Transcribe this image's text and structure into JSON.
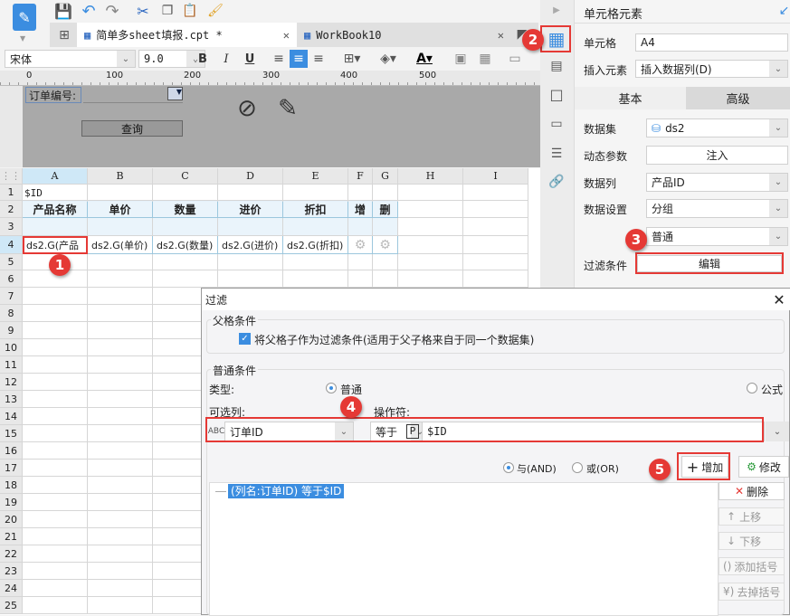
{
  "app": {
    "logo": "report-designer-logo"
  },
  "tabs": [
    {
      "label": "简单多sheet填报.cpt *",
      "active": true
    },
    {
      "label": "WorkBook10",
      "active": false
    }
  ],
  "format": {
    "font": "宋体",
    "size": "9.0",
    "bold": "B",
    "italic": "I",
    "underline": "U"
  },
  "ruler": [
    "0",
    "100",
    "200",
    "300",
    "400",
    "500"
  ],
  "params": {
    "label": "订单编号:",
    "query_button": "查询"
  },
  "sheet": {
    "columns": [
      "A",
      "B",
      "C",
      "D",
      "E",
      "F",
      "G",
      "H",
      "I"
    ],
    "rows": [
      "1",
      "2",
      "3",
      "4",
      "5",
      "6",
      "7",
      "8",
      "9",
      "10",
      "11",
      "12",
      "13",
      "14",
      "15",
      "16",
      "17",
      "18",
      "19",
      "20",
      "21",
      "22",
      "23",
      "24",
      "25"
    ],
    "a1": "$ID",
    "headers": [
      "产品名称",
      "单价",
      "数量",
      "进价",
      "折扣",
      "增",
      "删"
    ],
    "row4": [
      "ds2.G(产品",
      "ds2.G(单价)",
      "ds2.G(数量)",
      "ds2.G(进价)",
      "ds2.G(折扣)"
    ]
  },
  "panel": {
    "title": "单元格元素",
    "cell_label": "单元格",
    "cell_value": "A4",
    "insert_label": "插入元素",
    "insert_value": "插入数据列(D)",
    "tab_basic": "基本",
    "tab_advanced": "高级",
    "dataset_label": "数据集",
    "dataset_value": "ds2",
    "dynparam_label": "动态参数",
    "dynparam_button": "注入",
    "column_label": "数据列",
    "column_value": "产品ID",
    "setting_label": "数据设置",
    "setting_value": "分组",
    "setting_sub": "普通",
    "filter_label": "过滤条件",
    "filter_button": "编辑"
  },
  "dialog": {
    "title": "过滤",
    "parent_group": "父格条件",
    "parent_check": "将父格子作为过滤条件(适用于父子格来自于同一个数据集)",
    "normal_group": "普通条件",
    "type_label": "类型:",
    "type_normal": "普通",
    "type_formula": "公式",
    "column_label": "可选列:",
    "operator_label": "操作符:",
    "column_value": "订单ID",
    "operator_value": "等于",
    "param_icon": "P",
    "value": "$ID",
    "and_label": "与(AND)",
    "or_label": "或(OR)",
    "add_button": "增加",
    "modify_button": "修改",
    "condition": "(列名:订单ID) 等于$ID",
    "delete_button": "删除",
    "up_button": "上移",
    "down_button": "下移",
    "add_paren": "添加括号",
    "remove_paren": "去掉括号"
  },
  "badges": [
    "1",
    "2",
    "3",
    "4",
    "5"
  ],
  "colors": {
    "accent": "#3b8de0",
    "highlight": "#e53935"
  }
}
